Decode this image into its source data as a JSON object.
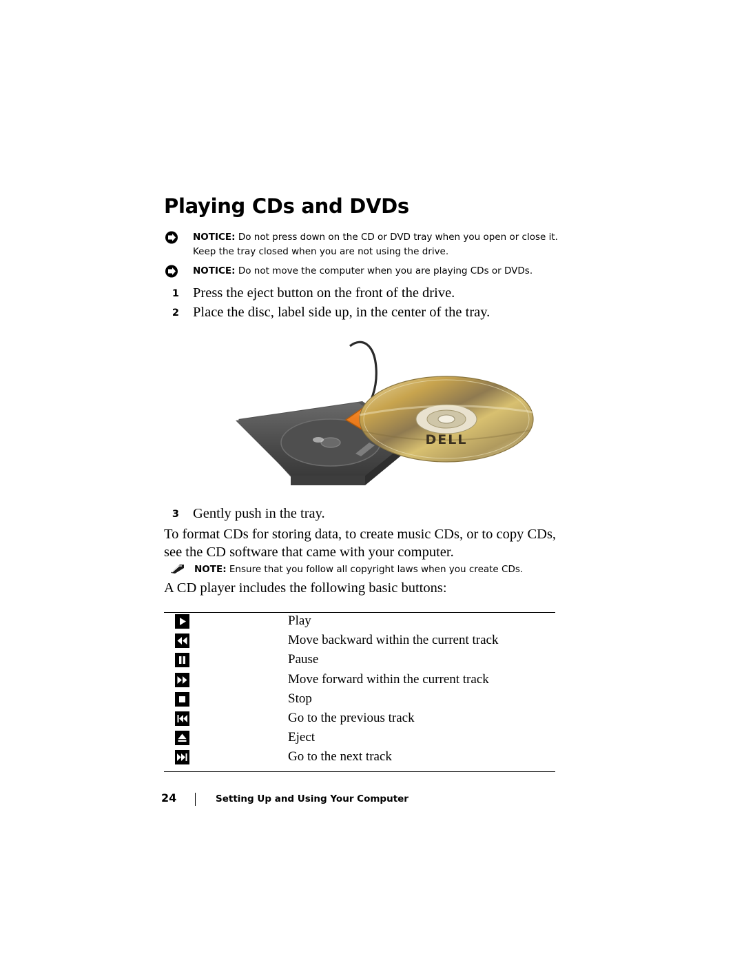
{
  "page": {
    "title": "Playing CDs and DVDs",
    "notices": [
      {
        "icon": "notice-arrow-icon",
        "label": "NOTICE:",
        "text": " Do not press down on the CD or DVD tray when you open or close it. Keep the tray closed when you are not using the drive."
      },
      {
        "icon": "notice-arrow-icon",
        "label": "NOTICE:",
        "text": " Do not move the computer when you are playing CDs or DVDs."
      }
    ],
    "steps_top": [
      {
        "num": "1",
        "text": "Press the eject button on the front of the drive."
      },
      {
        "num": "2",
        "text": "Place the disc, label side up, in the center of the tray."
      }
    ],
    "illustration": {
      "name": "cd-drive-tray-with-disc",
      "disc_logo": "DELL"
    },
    "steps_bottom": [
      {
        "num": "3",
        "text": "Gently push in the tray."
      }
    ],
    "paragraph1": "To format CDs for storing data, to create music CDs, or to copy CDs, see the CD software that came with your computer.",
    "note": {
      "icon": "note-pencil-icon",
      "label": "NOTE:",
      "text": " Ensure that you follow all copyright laws when you create CDs."
    },
    "paragraph2": "A CD player includes the following basic buttons:",
    "button_table": {
      "rows": [
        {
          "icon": "play-icon",
          "label": "Play"
        },
        {
          "icon": "rewind-icon",
          "label": "Move backward within the current track"
        },
        {
          "icon": "pause-icon",
          "label": "Pause"
        },
        {
          "icon": "fast-forward-icon",
          "label": "Move forward within the current track"
        },
        {
          "icon": "stop-icon",
          "label": "Stop"
        },
        {
          "icon": "previous-track-icon",
          "label": "Go to the previous track"
        },
        {
          "icon": "eject-icon",
          "label": "Eject"
        },
        {
          "icon": "next-track-icon",
          "label": "Go to the next track"
        }
      ]
    },
    "footer": {
      "page_number": "24",
      "section": "Setting Up and Using Your Computer"
    },
    "colors": {
      "text": "#000000",
      "background": "#ffffff",
      "arrow_accent": "#f08020",
      "disc_gold": "#c9a84c"
    }
  }
}
